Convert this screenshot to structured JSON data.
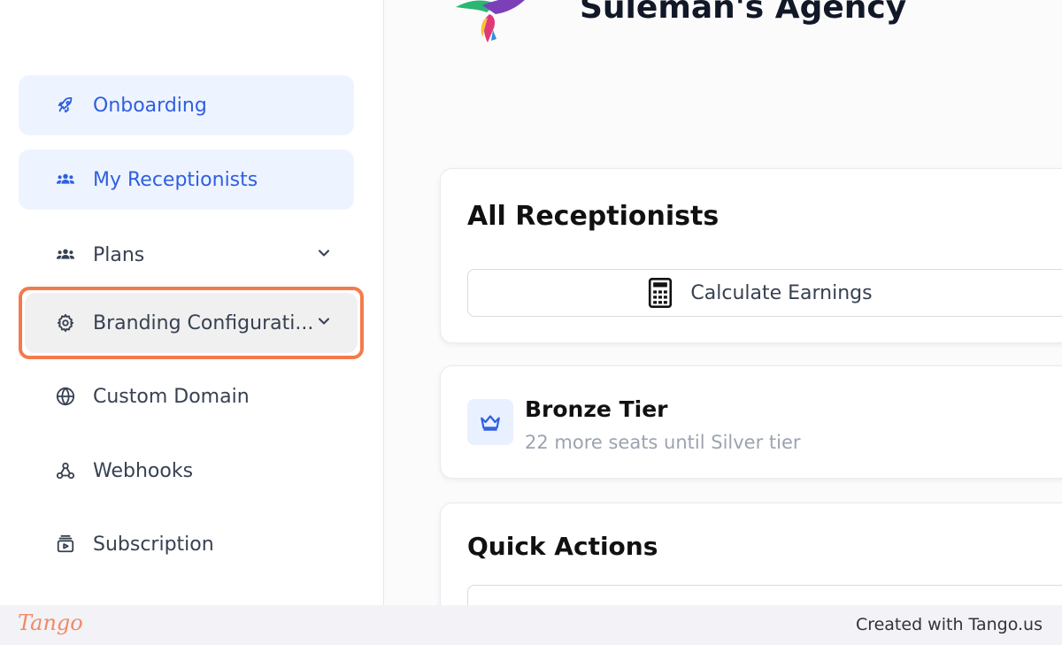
{
  "header": {
    "agency_name": "Suleman's Agency"
  },
  "sidebar": {
    "items": [
      {
        "label": "Onboarding",
        "icon": "rocket-icon",
        "active": true
      },
      {
        "label": "My Receptionists",
        "icon": "users-icon",
        "active": true
      },
      {
        "label": "Plans",
        "icon": "users-icon",
        "has_chevron": true
      },
      {
        "label": "Branding Configurati...",
        "icon": "gear-icon",
        "has_chevron": true,
        "highlighted": true
      },
      {
        "label": "Custom Domain",
        "icon": "globe-icon"
      },
      {
        "label": "Webhooks",
        "icon": "webhook-icon"
      },
      {
        "label": "Subscription",
        "icon": "subscription-icon"
      }
    ]
  },
  "main": {
    "receptionists": {
      "title": "All Receptionists",
      "calculate_label": "Calculate Earnings"
    },
    "tier": {
      "title": "Bronze Tier",
      "subtitle": "22 more seats until Silver tier",
      "icon": "crown-icon"
    },
    "quick_actions": {
      "title": "Quick Actions"
    }
  },
  "footer": {
    "brand": "Tango",
    "credit": "Created with Tango.us"
  },
  "colors": {
    "accent": "#2f5fe0",
    "active_bg": "#eef4ff",
    "highlight_ring": "#f47a4d"
  }
}
